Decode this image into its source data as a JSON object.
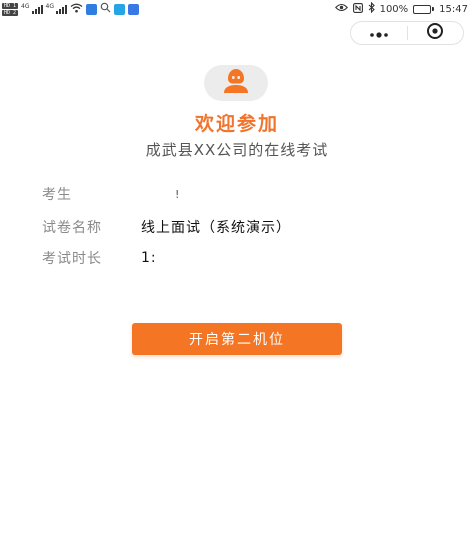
{
  "status_bar": {
    "hd_badges": [
      "HD 1",
      "HD 2"
    ],
    "signal_labels": [
      "4G",
      "4G"
    ],
    "battery_text": "100%",
    "battery_level": 1.0,
    "time": "15:47",
    "app_icon_colors": [
      "#2f7de1",
      "#25a5e6",
      "#3a78e6",
      "#2f7de1"
    ]
  },
  "capsule": {
    "more_icon": "more-dots-icon",
    "close_icon": "target-circle-icon"
  },
  "colors": {
    "accent": "#f47624",
    "title": "#f0742b",
    "avatar_bg": "#ececec"
  },
  "hero": {
    "avatar_icon": "user-icon",
    "title": "欢迎参加",
    "subtitle": "成武县XX公司的在线考试"
  },
  "info": [
    {
      "label": "考生",
      "value": "!"
    },
    {
      "label": "试卷名称",
      "value": "线上面试（系统演示）"
    },
    {
      "label": "考试时长",
      "value": "1:"
    }
  ],
  "actions": {
    "primary_label": "开启第二机位"
  }
}
